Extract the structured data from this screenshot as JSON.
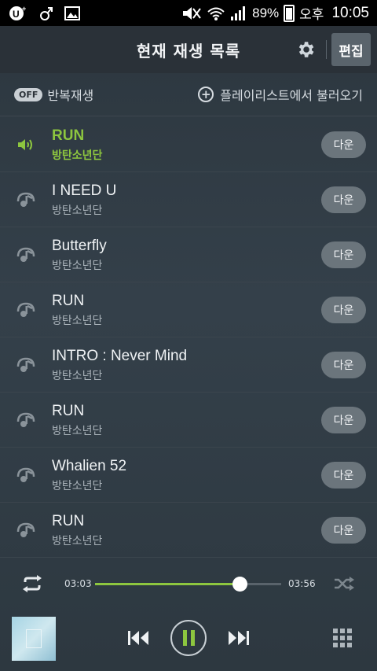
{
  "status_bar": {
    "battery": "89%",
    "ampm": "오후",
    "time": "10:05",
    "icons": [
      "u-plus-icon",
      "male-icon",
      "image-icon",
      "mute-icon",
      "wifi-icon",
      "signal-icon",
      "battery-icon"
    ]
  },
  "header": {
    "title": "현재 재생 목록",
    "edit_label": "편집"
  },
  "options": {
    "repeat_toggle": "OFF",
    "repeat_label": "반복재생",
    "load_playlist_label": "플레이리스트에서 불러오기"
  },
  "playlist": [
    {
      "song": "RUN",
      "artist": "방탄소년단",
      "down_label": "다운",
      "playing": true
    },
    {
      "song": "I NEED U",
      "artist": "방탄소년단",
      "down_label": "다운",
      "playing": false
    },
    {
      "song": "Butterfly",
      "artist": "방탄소년단",
      "down_label": "다운",
      "playing": false
    },
    {
      "song": "RUN",
      "artist": "방탄소년단",
      "down_label": "다운",
      "playing": false
    },
    {
      "song": "INTRO : Never Mind",
      "artist": "방탄소년단",
      "down_label": "다운",
      "playing": false
    },
    {
      "song": "RUN",
      "artist": "방탄소년단",
      "down_label": "다운",
      "playing": false
    },
    {
      "song": "Whalien 52",
      "artist": "방탄소년단",
      "down_label": "다운",
      "playing": false
    },
    {
      "song": "RUN",
      "artist": "방탄소년단",
      "down_label": "다운",
      "playing": false
    }
  ],
  "progress": {
    "current_time": "03:03",
    "total_time": "03:56",
    "fraction": 0.775
  },
  "colors": {
    "accent": "#8dc63f",
    "background": "#2c363e"
  }
}
